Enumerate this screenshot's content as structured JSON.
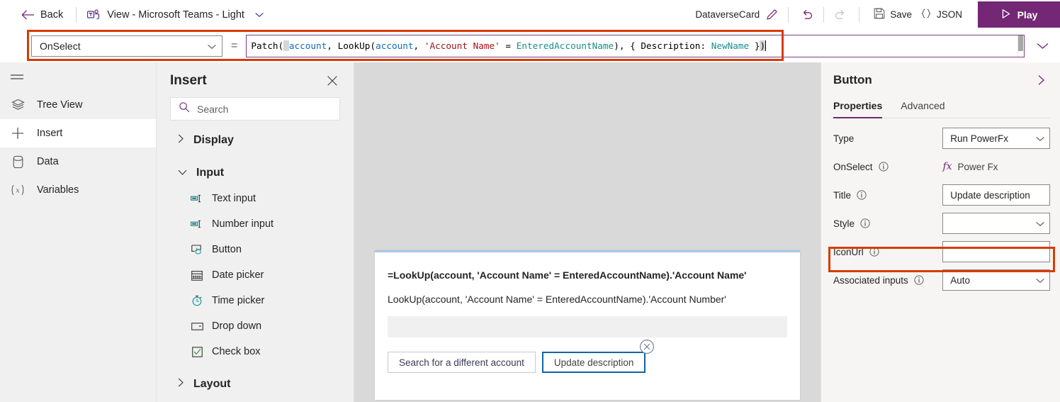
{
  "topbar": {
    "back_label": "Back",
    "view_title": "View - Microsoft Teams - Light",
    "card_name": "DataverseCard",
    "save_label": "Save",
    "json_label": "JSON",
    "play_label": "Play",
    "icons": {
      "back": "arrow-left-icon",
      "teams": "microsoft-teams-icon",
      "title_chevron": "chevron-down-icon",
      "pencil": "pencil-edit-icon",
      "undo": "undo-icon",
      "redo": "redo-icon",
      "save": "save-disk-icon",
      "json": "json-braces-icon",
      "play": "play-triangle-icon"
    },
    "accent_purple": "#742774"
  },
  "formula_bar": {
    "property_selected": "OnSelect",
    "equals": "=",
    "formula_tokens": [
      {
        "t": "Patch(",
        "k": "fn"
      },
      {
        "t": "account",
        "k": "tbl"
      },
      {
        "t": ", LookUp(",
        "k": "punct"
      },
      {
        "t": "account",
        "k": "tbl"
      },
      {
        "t": ", ",
        "k": "punct"
      },
      {
        "t": "'Account Name'",
        "k": "str"
      },
      {
        "t": " = ",
        "k": "punct"
      },
      {
        "t": "EnteredAccountName",
        "k": "var"
      },
      {
        "t": "), { Description: ",
        "k": "punct"
      },
      {
        "t": "NewName",
        "k": "var"
      },
      {
        "t": " })",
        "k": "punct"
      }
    ],
    "formula_plain": "Patch(account, LookUp(account, 'Account Name' = EnteredAccountName), { Description: NewName })",
    "highlight_color": "#d83b01",
    "expand_icon": "chevron-down-icon",
    "dropdown_icon": "chevron-down-icon"
  },
  "rail": {
    "menu_icon": "hamburger-menu-icon",
    "items": [
      {
        "label": "Tree View",
        "icon": "layers-icon",
        "active": false
      },
      {
        "label": "Insert",
        "icon": "plus-icon",
        "active": true
      },
      {
        "label": "Data",
        "icon": "database-icon",
        "active": false
      },
      {
        "label": "Variables",
        "icon": "variable-x-icon",
        "active": false
      }
    ]
  },
  "insert_panel": {
    "title": "Insert",
    "close_icon": "close-icon",
    "search_placeholder": "Search",
    "search_icon": "search-icon",
    "groups": [
      {
        "label": "Display",
        "expanded": false,
        "chevron": "chevron-right-icon",
        "items": []
      },
      {
        "label": "Input",
        "expanded": true,
        "chevron": "chevron-down-icon",
        "items": [
          {
            "label": "Text input",
            "icon": "text-input-icon"
          },
          {
            "label": "Number input",
            "icon": "number-input-icon"
          },
          {
            "label": "Button",
            "icon": "button-icon"
          },
          {
            "label": "Date picker",
            "icon": "calendar-icon"
          },
          {
            "label": "Time picker",
            "icon": "clock-icon"
          },
          {
            "label": "Drop down",
            "icon": "dropdown-icon"
          },
          {
            "label": "Check box",
            "icon": "checkbox-icon"
          }
        ]
      },
      {
        "label": "Layout",
        "expanded": false,
        "chevron": "chevron-right-icon",
        "items": []
      }
    ]
  },
  "canvas": {
    "card": {
      "line1": "=LookUp(account, 'Account Name' = EnteredAccountName).'Account Name'",
      "line2": "LookUp(account, 'Account Name' = EnteredAccountName).'Account Number'",
      "text_input_value": "",
      "buttons": [
        {
          "label": "Search for a different account",
          "selected": false
        },
        {
          "label": "Update description",
          "selected": true
        }
      ],
      "delete_handle_icon": "circle-close-icon"
    }
  },
  "properties": {
    "title": "Button",
    "collapse_icon": "chevron-right-icon",
    "tabs": [
      {
        "label": "Properties",
        "active": true
      },
      {
        "label": "Advanced",
        "active": false
      }
    ],
    "rows": [
      {
        "label": "Type",
        "value": "Run PowerFx",
        "kind": "select",
        "info": true
      },
      {
        "label": "OnSelect",
        "value": "Power Fx",
        "kind": "fx",
        "info": true
      },
      {
        "label": "Title",
        "value": "Update description",
        "kind": "text",
        "info": true,
        "highlighted": true
      },
      {
        "label": "Style",
        "value": "",
        "kind": "select",
        "info": true
      },
      {
        "label": "IconUrl",
        "value": "",
        "kind": "text",
        "info": true
      },
      {
        "label": "Associated inputs",
        "value": "Auto",
        "kind": "select",
        "info": true
      }
    ],
    "highlight_color": "#d83b01",
    "active_tab_color": "#742774"
  }
}
